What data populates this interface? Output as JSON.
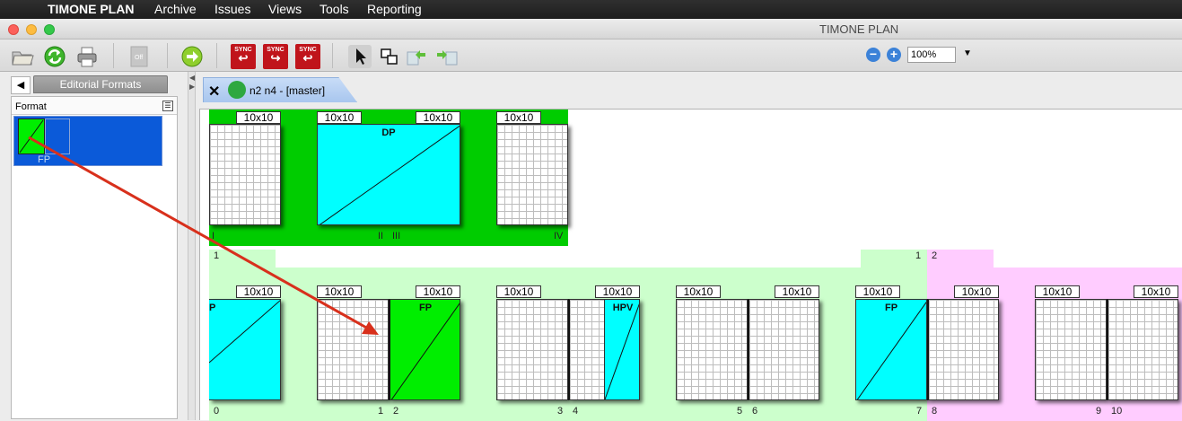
{
  "menubar": {
    "app": "TIMONE PLAN",
    "items": [
      "Archive",
      "Issues",
      "Views",
      "Tools",
      "Reporting"
    ]
  },
  "window": {
    "title": "TIMONE PLAN"
  },
  "toolbar": {
    "sync_text": "SYNC",
    "zoom_value": "100%"
  },
  "left_panel": {
    "tab_label": "Editorial Formats",
    "column_header": "Format",
    "format_item": "FP"
  },
  "document_tab": {
    "label": "n2 n4 - [master]"
  },
  "pages": {
    "size_label": "10x10",
    "top": {
      "dp": "DP",
      "folio_I": "I",
      "folio_II": "II",
      "folio_III": "III",
      "folio_IV": "IV",
      "sec_1": "1",
      "sec_2": "1",
      "sec_3": "2"
    },
    "bottom": {
      "p0": "P",
      "fp1": "FP",
      "hpv": "HPV",
      "fp2": "FP",
      "n0": "0",
      "n1": "1",
      "n2": "2",
      "n3": "3",
      "n4": "4",
      "n5": "5",
      "n6": "6",
      "n7": "7",
      "n8": "8",
      "n9": "9",
      "n10": "10"
    }
  },
  "colors": {
    "green": "#00cc00",
    "light_green": "#ccffcc",
    "pink": "#ffccff",
    "cyan": "#00ffff",
    "fp_green": "#00ee00",
    "selection": "#0b5ad9",
    "arrow": "#d8301c"
  }
}
